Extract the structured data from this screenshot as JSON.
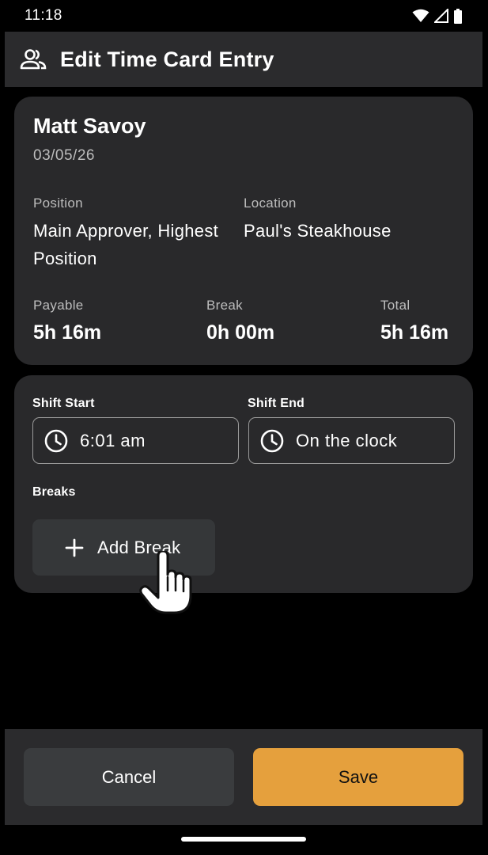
{
  "status_bar": {
    "time": "11:18"
  },
  "app_bar": {
    "title": "Edit Time Card Entry",
    "icon": "people-icon"
  },
  "summary": {
    "employee_name": "Matt Savoy",
    "date": "03/05/26",
    "position_label": "Position",
    "position_value": "Main Approver, Highest Position",
    "location_label": "Location",
    "location_value": "Paul's Steakhouse",
    "payable_label": "Payable",
    "payable_value": "5h 16m",
    "break_label": "Break",
    "break_value": "0h 00m",
    "total_label": "Total",
    "total_value": "5h 16m"
  },
  "shift": {
    "start_label": "Shift Start",
    "start_value": "6:01 am",
    "end_label": "Shift End",
    "end_value": "On the clock",
    "breaks_label": "Breaks",
    "add_break_label": "Add Break"
  },
  "actions": {
    "cancel_label": "Cancel",
    "save_label": "Save"
  },
  "colors": {
    "background": "#000000",
    "surface": "#29292b",
    "accent": "#e5a03d",
    "secondary_button": "#3a3c3e"
  }
}
